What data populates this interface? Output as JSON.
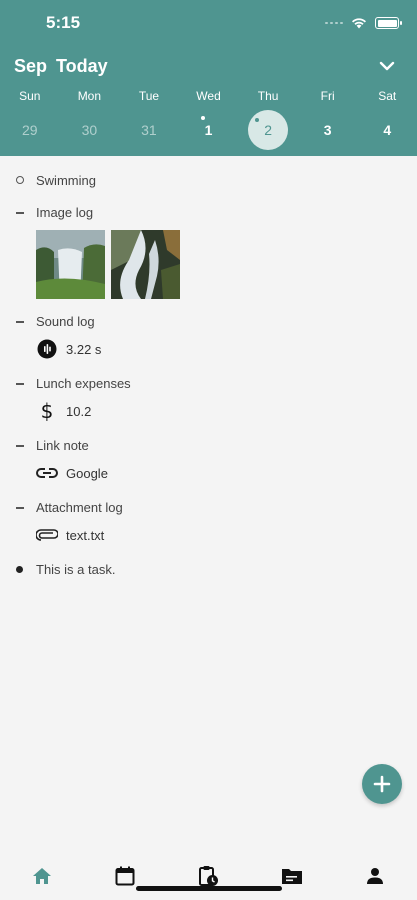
{
  "status_bar": {
    "time": "5:15"
  },
  "header": {
    "month": "Sep",
    "today_label": "Today"
  },
  "colors": {
    "accent": "#4f9590",
    "selected_circle": "#d8e8e6",
    "background": "#f4f4f4"
  },
  "week": [
    {
      "name": "Sun",
      "num": "29",
      "past": true,
      "has_dot": false,
      "selected": false
    },
    {
      "name": "Mon",
      "num": "30",
      "past": true,
      "has_dot": false,
      "selected": false
    },
    {
      "name": "Tue",
      "num": "31",
      "past": true,
      "has_dot": false,
      "selected": false
    },
    {
      "name": "Wed",
      "num": "1",
      "past": false,
      "has_dot": true,
      "selected": false
    },
    {
      "name": "Thu",
      "num": "2",
      "past": false,
      "has_dot": true,
      "selected": true
    },
    {
      "name": "Fri",
      "num": "3",
      "past": false,
      "has_dot": false,
      "selected": false
    },
    {
      "name": "Sat",
      "num": "4",
      "past": false,
      "has_dot": false,
      "selected": false
    }
  ],
  "entries": {
    "swimming": {
      "title": "Swimming",
      "bullet": "circle"
    },
    "image_log": {
      "title": "Image log",
      "bullet": "dash",
      "images": [
        "waterfall-image",
        "cascade-image"
      ]
    },
    "sound_log": {
      "title": "Sound log",
      "bullet": "dash",
      "value": "3.22 s",
      "icon": "audio-icon"
    },
    "lunch": {
      "title": "Lunch expenses",
      "bullet": "dash",
      "value": "10.2",
      "icon": "dollar-icon"
    },
    "link_note": {
      "title": "Link note",
      "bullet": "dash",
      "value": "Google",
      "icon": "link-icon"
    },
    "attachment": {
      "title": "Attachment log",
      "bullet": "dash",
      "value": "text.txt",
      "icon": "paperclip-icon"
    },
    "task": {
      "title": "This is a task.",
      "bullet": "dot"
    }
  },
  "fab": {
    "icon": "plus-icon"
  },
  "tabbar": [
    "home-icon",
    "calendar-icon",
    "clipboard-clock-icon",
    "folder-icon",
    "person-icon"
  ]
}
